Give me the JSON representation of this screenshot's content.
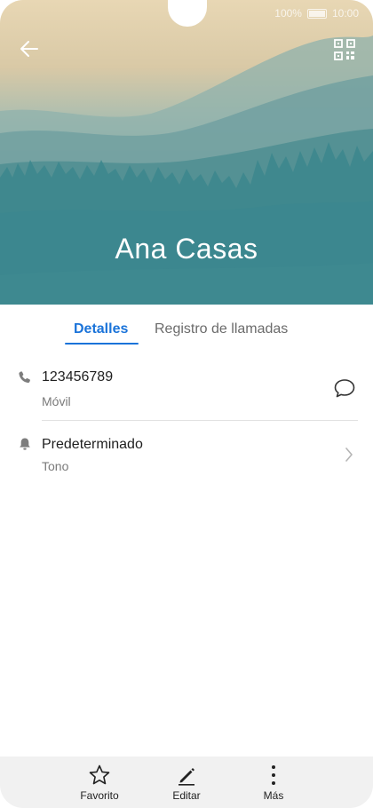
{
  "status_bar": {
    "battery": "100%",
    "time": "10:00"
  },
  "contact": {
    "name": "Ana Casas"
  },
  "tabs": [
    {
      "label": "Detalles"
    },
    {
      "label": "Registro de llamadas"
    }
  ],
  "phone_row": {
    "number": "123456789",
    "type": "Móvil"
  },
  "ringtone_row": {
    "value": "Predeterminado",
    "label": "Tono"
  },
  "bottom_bar": {
    "favorite": "Favorito",
    "edit": "Editar",
    "more": "Más"
  },
  "colors": {
    "accent": "#1a73d9",
    "header_bottom": "#3f8c92",
    "header_top": "#e8d7b4"
  }
}
